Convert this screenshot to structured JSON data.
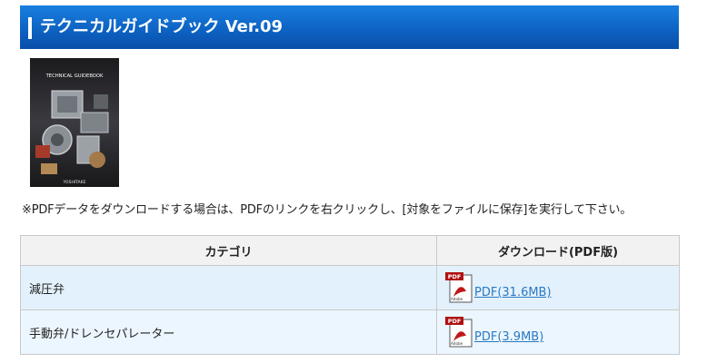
{
  "header": {
    "title": "テクニカルガイドブック Ver.09"
  },
  "cover": {
    "title": "TECHNICAL GUIDEBOOK",
    "brand": "YOSHITAKE"
  },
  "note": "※PDFデータをダウンロードする場合は、PDFのリンクを右クリックし、[対象をファイルに保存]を実行して下さい。",
  "table": {
    "headers": [
      "カテゴリ",
      "ダウンロード(PDF版)"
    ],
    "rows": [
      {
        "category": "減圧弁",
        "link": "PDF(31.6MB)"
      },
      {
        "category": "手動弁/ドレンセパレーター",
        "link": "PDF(3.9MB)"
      }
    ]
  },
  "pdf_icon": {
    "badge": "PDF",
    "brand": "Adobe"
  }
}
